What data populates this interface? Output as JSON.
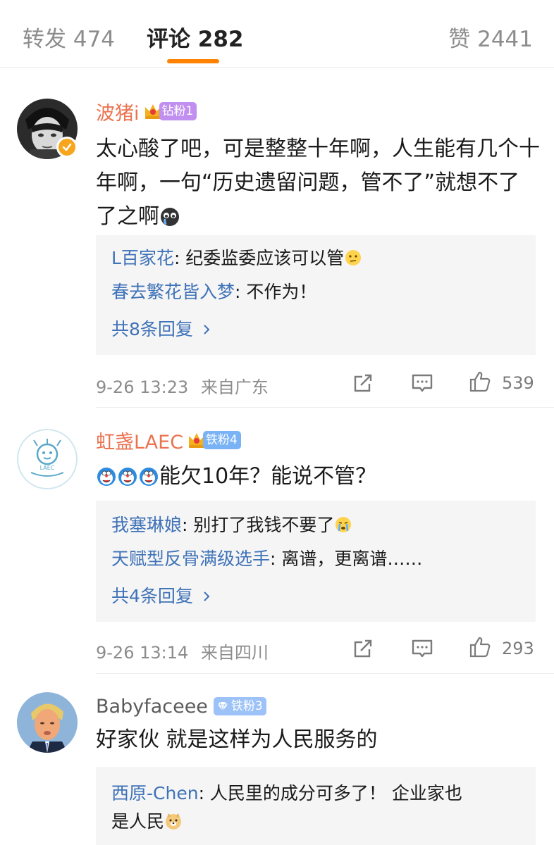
{
  "tabs": {
    "repost": "转发 474",
    "comment": "评论 282",
    "like": "赞 2441"
  },
  "colors": {
    "accent": "#ff8200",
    "username_orange": "#eb7350",
    "reply_link": "#3f72b8",
    "verified": "#f7a51c"
  },
  "comments": [
    {
      "username": "波猪i",
      "avatar_icon": "anime-avatar",
      "verified_icon": "verified-badge-icon",
      "crown_icon": "crown-icon",
      "fan_badge": "钻粉1",
      "text": "太心酸了吧，可是整整十年啊，人生能有几个十年啊，一句“历史遗留问题，管不了”就想不了了之啊",
      "text_emoji": "crying-face-emoji",
      "replies": [
        {
          "name": "L百家花",
          "content": ": 纪委监委应该可以管",
          "emoji": "thinking-face-emoji"
        },
        {
          "name": "春去繁花皆入梦",
          "content": ": 不作为！"
        }
      ],
      "more_replies": "共8条回复",
      "time": "9-26 13:23",
      "location": "来自广东",
      "likes": "539"
    },
    {
      "username": "虹盏LAEC",
      "avatar_icon": "laec-logo-avatar",
      "crown_icon": "crown-icon",
      "fan_badge": "铁粉4",
      "text_emojis": [
        "doraemon-emoji",
        "doraemon-emoji",
        "doraemon-emoji"
      ],
      "text": "能欠10年？能说不管？",
      "replies": [
        {
          "name": "我塞琳娘",
          "content": ": 别打了我钱不要了",
          "emoji": "crying-emoji"
        },
        {
          "name": "天赋型反骨满级选手",
          "content": ": 离谱，更离谱……"
        }
      ],
      "more_replies": "共4条回复",
      "time": "9-26 13:14",
      "location": "来自四川",
      "likes": "293"
    },
    {
      "username": "Babyfaceee",
      "avatar_icon": "person-avatar",
      "fan_badge": "铁粉3",
      "text": "好家伙 就是这样为人民服务的",
      "replies": [
        {
          "name": "西原-Chen",
          "content_line1": ": 人民里的成分可多了！ 企业家也",
          "content_line2": "是人民",
          "emoji": "doge-emoji"
        }
      ]
    }
  ],
  "icons": {
    "share": "share-icon",
    "comment": "comment-icon",
    "like": "thumbs-up-icon",
    "more": "chevron-right-icon"
  }
}
